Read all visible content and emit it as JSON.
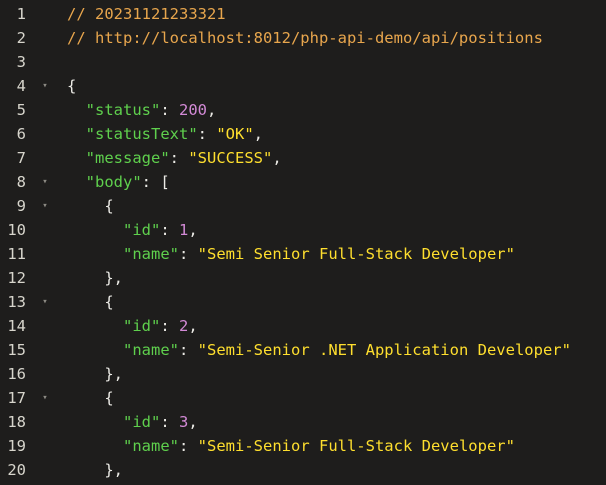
{
  "editor": {
    "lines": [
      {
        "num": "1",
        "fold": "",
        "parts": [
          {
            "cls": "comment",
            "text": "// 20231121233321"
          }
        ]
      },
      {
        "num": "2",
        "fold": "",
        "parts": [
          {
            "cls": "comment",
            "text": "// http://localhost:8012/php-api-demo/api/positions"
          }
        ]
      },
      {
        "num": "3",
        "fold": "",
        "parts": []
      },
      {
        "num": "4",
        "fold": "▾",
        "parts": [
          {
            "cls": "punc",
            "text": "{"
          }
        ]
      },
      {
        "num": "5",
        "fold": "",
        "parts": [
          {
            "cls": "punc",
            "text": "  "
          },
          {
            "cls": "key",
            "text": "\"status\""
          },
          {
            "cls": "punc",
            "text": ": "
          },
          {
            "cls": "num",
            "text": "200"
          },
          {
            "cls": "punc",
            "text": ","
          }
        ]
      },
      {
        "num": "6",
        "fold": "",
        "parts": [
          {
            "cls": "punc",
            "text": "  "
          },
          {
            "cls": "key",
            "text": "\"statusText\""
          },
          {
            "cls": "punc",
            "text": ": "
          },
          {
            "cls": "str",
            "text": "\"OK\""
          },
          {
            "cls": "punc",
            "text": ","
          }
        ]
      },
      {
        "num": "7",
        "fold": "",
        "parts": [
          {
            "cls": "punc",
            "text": "  "
          },
          {
            "cls": "key",
            "text": "\"message\""
          },
          {
            "cls": "punc",
            "text": ": "
          },
          {
            "cls": "str",
            "text": "\"SUCCESS\""
          },
          {
            "cls": "punc",
            "text": ","
          }
        ]
      },
      {
        "num": "8",
        "fold": "▾",
        "parts": [
          {
            "cls": "punc",
            "text": "  "
          },
          {
            "cls": "key",
            "text": "\"body\""
          },
          {
            "cls": "punc",
            "text": ": ["
          }
        ]
      },
      {
        "num": "9",
        "fold": "▾",
        "parts": [
          {
            "cls": "punc",
            "text": "    {"
          }
        ]
      },
      {
        "num": "10",
        "fold": "",
        "parts": [
          {
            "cls": "punc",
            "text": "      "
          },
          {
            "cls": "key",
            "text": "\"id\""
          },
          {
            "cls": "punc",
            "text": ": "
          },
          {
            "cls": "num",
            "text": "1"
          },
          {
            "cls": "punc",
            "text": ","
          }
        ]
      },
      {
        "num": "11",
        "fold": "",
        "parts": [
          {
            "cls": "punc",
            "text": "      "
          },
          {
            "cls": "key",
            "text": "\"name\""
          },
          {
            "cls": "punc",
            "text": ": "
          },
          {
            "cls": "str",
            "text": "\"Semi Senior Full-Stack Developer\""
          }
        ]
      },
      {
        "num": "12",
        "fold": "",
        "parts": [
          {
            "cls": "punc",
            "text": "    },"
          }
        ]
      },
      {
        "num": "13",
        "fold": "▾",
        "parts": [
          {
            "cls": "punc",
            "text": "    {"
          }
        ]
      },
      {
        "num": "14",
        "fold": "",
        "parts": [
          {
            "cls": "punc",
            "text": "      "
          },
          {
            "cls": "key",
            "text": "\"id\""
          },
          {
            "cls": "punc",
            "text": ": "
          },
          {
            "cls": "num",
            "text": "2"
          },
          {
            "cls": "punc",
            "text": ","
          }
        ]
      },
      {
        "num": "15",
        "fold": "",
        "parts": [
          {
            "cls": "punc",
            "text": "      "
          },
          {
            "cls": "key",
            "text": "\"name\""
          },
          {
            "cls": "punc",
            "text": ": "
          },
          {
            "cls": "str",
            "text": "\"Semi-Senior .NET Application Developer\""
          }
        ]
      },
      {
        "num": "16",
        "fold": "",
        "parts": [
          {
            "cls": "punc",
            "text": "    },"
          }
        ]
      },
      {
        "num": "17",
        "fold": "▾",
        "parts": [
          {
            "cls": "punc",
            "text": "    {"
          }
        ]
      },
      {
        "num": "18",
        "fold": "",
        "parts": [
          {
            "cls": "punc",
            "text": "      "
          },
          {
            "cls": "key",
            "text": "\"id\""
          },
          {
            "cls": "punc",
            "text": ": "
          },
          {
            "cls": "num",
            "text": "3"
          },
          {
            "cls": "punc",
            "text": ","
          }
        ]
      },
      {
        "num": "19",
        "fold": "",
        "parts": [
          {
            "cls": "punc",
            "text": "      "
          },
          {
            "cls": "key",
            "text": "\"name\""
          },
          {
            "cls": "punc",
            "text": ": "
          },
          {
            "cls": "str",
            "text": "\"Semi-Senior Full-Stack Developer\""
          }
        ]
      },
      {
        "num": "20",
        "fold": "",
        "parts": [
          {
            "cls": "punc",
            "text": "    },"
          }
        ]
      }
    ]
  },
  "colors": {
    "background": "#1e1d1c",
    "comment": "#e8a64d",
    "key": "#5fd04d",
    "number": "#d38ad6",
    "string": "#ffdf2e",
    "line_number": "#d7d5cc"
  }
}
